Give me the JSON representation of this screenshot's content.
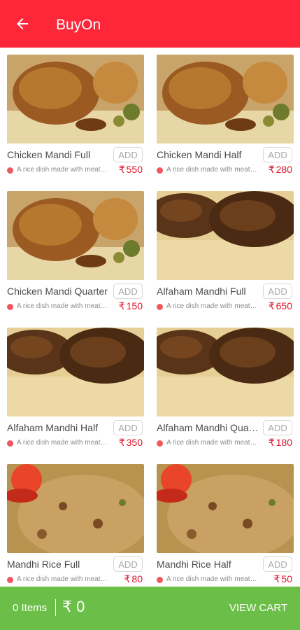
{
  "appbar": {
    "title": "BuyOn",
    "back_icon": "arrow-left-icon",
    "color": "#fe2739"
  },
  "products": [
    {
      "name": "Chicken Mandi Full",
      "desc": "A rice dish made with meat, rice and spices",
      "currency": "₹",
      "price": "550",
      "add_label": "ADD",
      "image": "chicken"
    },
    {
      "name": "Chicken Mandi Half",
      "desc": "A rice dish made with meat, rice and spices",
      "currency": "₹",
      "price": "280",
      "add_label": "ADD",
      "image": "chicken"
    },
    {
      "name": "Chicken Mandi Quarter",
      "desc": "A rice dish made with meat, rice and spices",
      "currency": "₹",
      "price": "150",
      "add_label": "ADD",
      "image": "chicken"
    },
    {
      "name": "Alfaham Mandhi Full",
      "desc": "A rice dish made with meat, rice and spices",
      "currency": "₹",
      "price": "650",
      "add_label": "ADD",
      "image": "alfaham"
    },
    {
      "name": "Alfaham Mandhi Half",
      "desc": "A rice dish made with meat, rice and spices",
      "currency": "₹",
      "price": "350",
      "add_label": "ADD",
      "image": "alfaham"
    },
    {
      "name": "Alfaham Mandhi Quarter",
      "desc": "A rice dish made with meat, rice and spices",
      "currency": "₹",
      "price": "180",
      "add_label": "ADD",
      "image": "alfaham"
    },
    {
      "name": "Mandhi Rice Full",
      "desc": "A rice dish made with meat, rice and spices",
      "currency": "₹",
      "price": "80",
      "add_label": "ADD",
      "image": "rice"
    },
    {
      "name": "Mandhi Rice Half",
      "desc": "A rice dish made with meat, rice and spices",
      "currency": "₹",
      "price": "50",
      "add_label": "ADD",
      "image": "rice"
    }
  ],
  "cart": {
    "items_label": "0 Items",
    "currency": "₹",
    "total": "0",
    "view_cart_label": "VIEW CART",
    "color": "#6bbf48"
  },
  "colors": {
    "price": "#e0152a",
    "dot": "#f0585c"
  }
}
